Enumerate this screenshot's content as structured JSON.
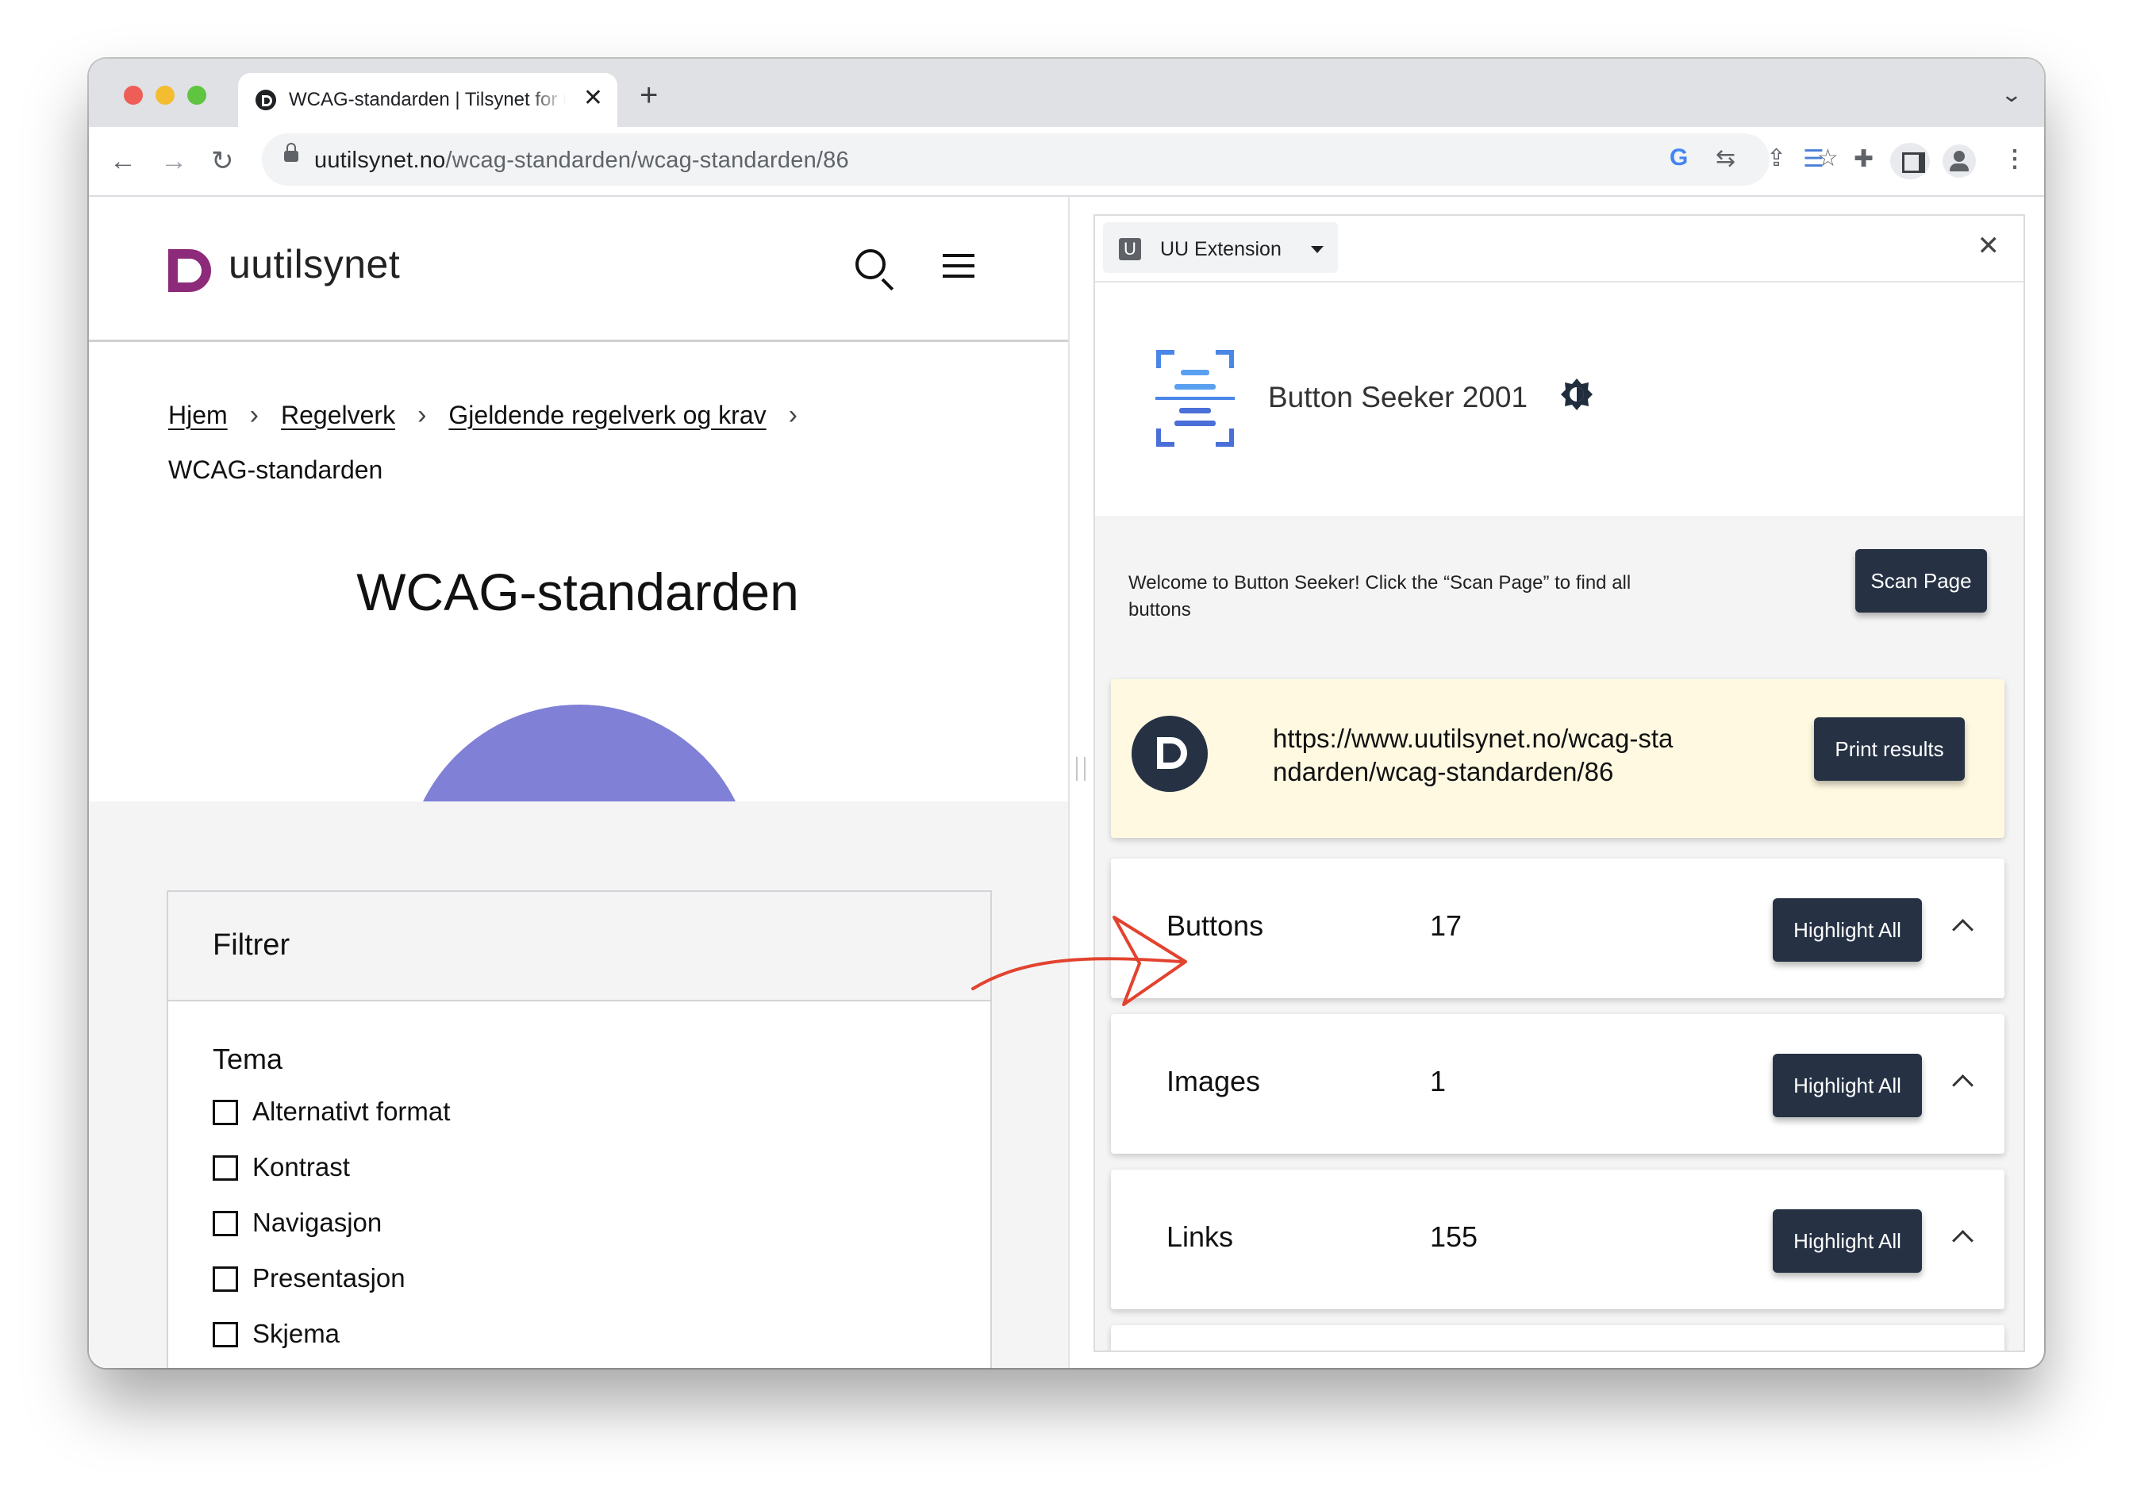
{
  "browser": {
    "tab_title": "WCAG-standarden | Tilsynet for universell utforming",
    "tab_close": "✕",
    "new_tab": "+",
    "url_host": "uutilsynet.no",
    "url_path": "/wcag-standarden/wcag-standarden/86",
    "colors": {
      "close": "#ee5e56",
      "minimize": "#f4bc2f",
      "maximize": "#5fc43f"
    }
  },
  "site": {
    "logo_text": "uutilsynet",
    "breadcrumbs": [
      "Hjem",
      "Regelverk",
      "Gjeldende regelverk og krav"
    ],
    "breadcrumb_current": "WCAG-standarden",
    "title": "WCAG-standarden",
    "filter": {
      "title": "Filtrer",
      "group": "Tema",
      "options": [
        "Alternativt format",
        "Kontrast",
        "Navigasjon",
        "Presentasjon",
        "Skjema"
      ]
    }
  },
  "panel": {
    "extension_name": "UU Extension",
    "extension_icon_letter": "U",
    "close": "✕",
    "app_name": "Button Seeker 2001",
    "welcome": "Welcome to Button Seeker! Click the “Scan Page” to find all buttons",
    "scan_button": "Scan Page",
    "page_url": "https://www.uutilsynet.no/wcag-standarden/wcag-standarden/86",
    "print_button": "Print results",
    "stats": [
      {
        "label": "Buttons",
        "count": "17",
        "action": "Highlight All"
      },
      {
        "label": "Images",
        "count": "1",
        "action": "Highlight All"
      },
      {
        "label": "Links",
        "count": "155",
        "action": "Highlight All"
      }
    ]
  }
}
